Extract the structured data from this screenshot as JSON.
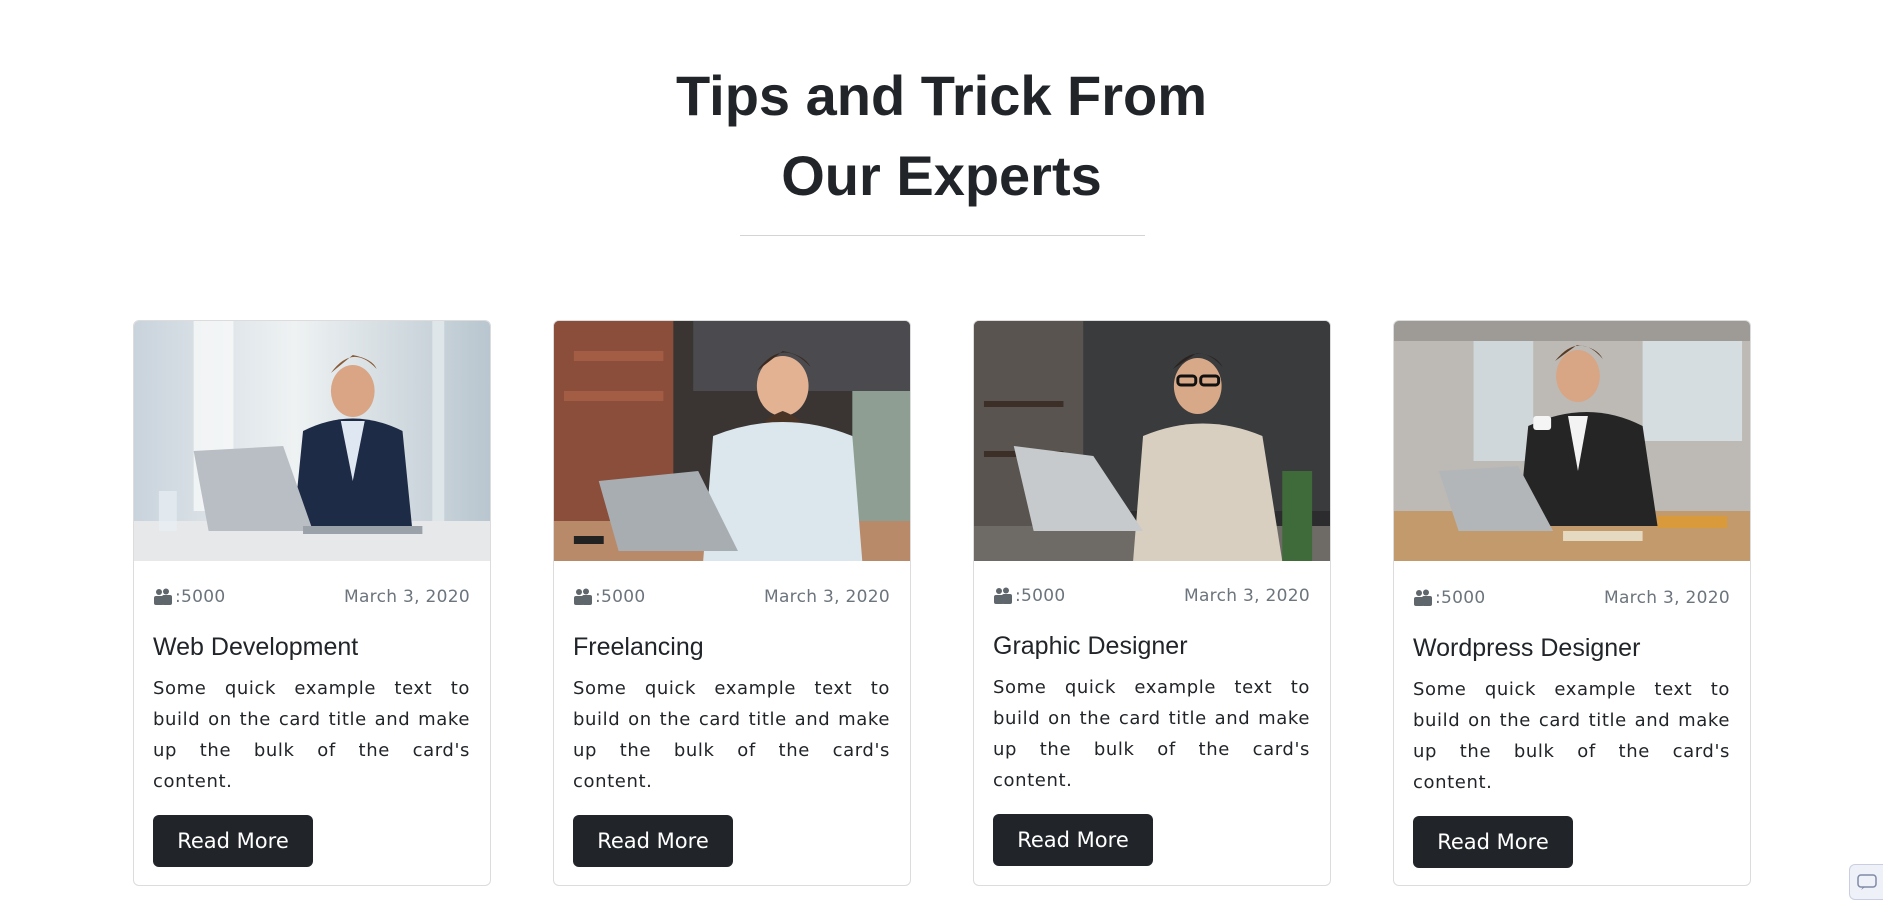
{
  "header": {
    "title_line1": "Tips and Trick From",
    "title_line2": "Our Experts"
  },
  "cards": [
    {
      "title": "Web Development",
      "views": ":5000",
      "date": "March 3, 2020",
      "text": "Some quick example text to build on the card title and make up the bulk of the card's content.",
      "button": "Read More",
      "image": "man-with-laptop-bright-office"
    },
    {
      "title": "Freelancing",
      "views": ":5000",
      "date": "March 3, 2020",
      "text": "Some quick example text to build on the card title and make up the bulk of the card's content.",
      "button": "Read More",
      "image": "man-with-laptop-brick-cafe"
    },
    {
      "title": "Graphic Designer",
      "views": ":5000",
      "date": "March 3, 2020",
      "text": "Some quick example text to build on the card title and make up the bulk of the card's content.",
      "button": "Read More",
      "image": "man-with-glasses-laptop-dark-office"
    },
    {
      "title": "Wordpress Designer",
      "views": ":5000",
      "date": "March 3, 2020",
      "text": "Some quick example text to build on the card title and make up the bulk of the card's content.",
      "button": "Read More",
      "image": "man-with-coffee-laptop-office"
    }
  ],
  "icons": {
    "views": "users-icon",
    "corner": "chat-widget-icon"
  },
  "colors": {
    "button_bg": "#212529",
    "text": "#212529",
    "muted": "#6c757d"
  }
}
